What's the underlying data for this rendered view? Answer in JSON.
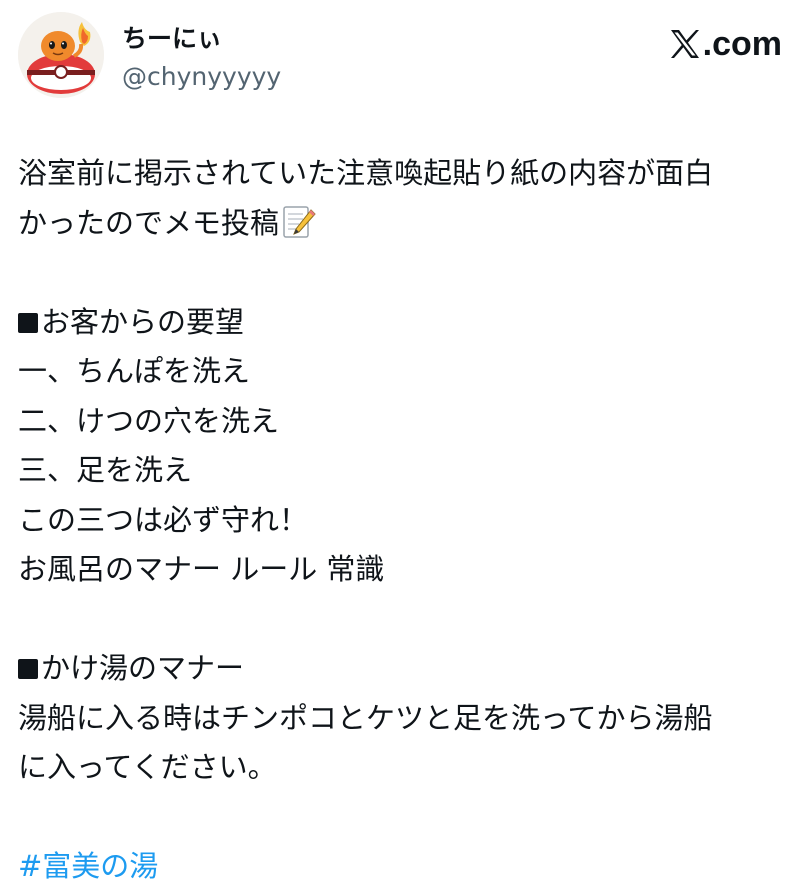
{
  "user": {
    "display_name": "ちーにぃ",
    "handle": "@chynyyyyy"
  },
  "brand": {
    "label": ".com",
    "icon": "x-logo-icon"
  },
  "tweet": {
    "lines": [
      "浴室前に掲示されていた注意喚起貼り紙の内容が面白",
      "かったのでメモ投稿",
      "",
      "お客からの要望",
      "一、ちんぽを洗え",
      "二、けつの穴を洗え",
      "三、足を洗え",
      "この三つは必ず守れ！",
      "お風呂のマナー ルール 常識",
      "",
      "かけ湯のマナー",
      "湯船に入る時はチンポコとケツと足を洗ってから湯船",
      "に入ってください。",
      ""
    ],
    "hashtag": "#富美の湯"
  },
  "colors": {
    "text": "#0f1419",
    "secondary": "#536471",
    "link": "#1d9bf0"
  }
}
